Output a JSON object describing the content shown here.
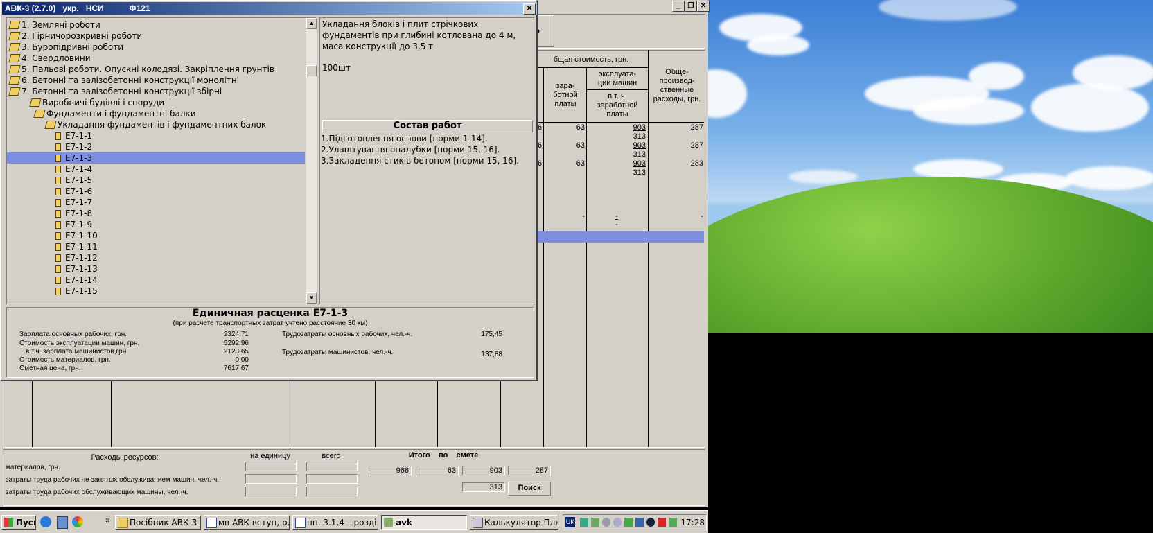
{
  "dialog": {
    "title": "АВК-3 (2.7.0)   укр.   НСИ           Ф121",
    "close": "✕"
  },
  "tree": [
    {
      "label": "1. Земляні роботи",
      "level": 0,
      "icon": "book-icon"
    },
    {
      "label": "2. Гірничорозкривні роботи",
      "level": 0,
      "icon": "book-icon"
    },
    {
      "label": "3. Буропідривні роботи",
      "level": 0,
      "icon": "book-icon"
    },
    {
      "label": "4. Свердловини",
      "level": 0,
      "icon": "book-icon"
    },
    {
      "label": "5. Пальові роботи. Опускні колодязі. Закріплення грунтів",
      "level": 0,
      "icon": "book-icon"
    },
    {
      "label": "6. Бетонні та залізобетонні конструкції монолітні",
      "level": 0,
      "icon": "book-icon"
    },
    {
      "label": "7. Бетонні та залізобетонні конструкції збірні",
      "level": 0,
      "icon": "open-book-icon"
    },
    {
      "label": "Виробничі будівлі і споруди",
      "level": 1,
      "icon": "open-book-icon"
    },
    {
      "label": "Фундаменти і фундаментні балки",
      "level": 2,
      "icon": "open-book-icon"
    },
    {
      "label": "Укладання фундаментів і фундаментних балок",
      "level": 3,
      "icon": "open-book-icon"
    },
    {
      "label": "Е7-1-1",
      "level": 4,
      "icon": "page-icon"
    },
    {
      "label": "Е7-1-2",
      "level": 4,
      "icon": "page-icon"
    },
    {
      "label": "Е7-1-3",
      "level": 4,
      "icon": "page-icon",
      "selected": true
    },
    {
      "label": "Е7-1-4",
      "level": 4,
      "icon": "page-icon"
    },
    {
      "label": "Е7-1-5",
      "level": 4,
      "icon": "page-icon"
    },
    {
      "label": "Е7-1-6",
      "level": 4,
      "icon": "page-icon"
    },
    {
      "label": "Е7-1-7",
      "level": 4,
      "icon": "page-icon"
    },
    {
      "label": "Е7-1-8",
      "level": 4,
      "icon": "page-icon"
    },
    {
      "label": "Е7-1-9",
      "level": 4,
      "icon": "page-icon"
    },
    {
      "label": "Е7-1-10",
      "level": 4,
      "icon": "page-icon"
    },
    {
      "label": "Е7-1-11",
      "level": 4,
      "icon": "page-icon"
    },
    {
      "label": "Е7-1-12",
      "level": 4,
      "icon": "page-icon"
    },
    {
      "label": "Е7-1-13",
      "level": 4,
      "icon": "page-icon"
    },
    {
      "label": "Е7-1-14",
      "level": 4,
      "icon": "page-icon"
    },
    {
      "label": "Е7-1-15",
      "level": 4,
      "icon": "page-icon"
    }
  ],
  "description": {
    "text": "Укладання блоків і плит стрічкових фундаментів при глибині котлована до 4 м, маса конструкції до 3,5 т",
    "unit": "100шт"
  },
  "works": {
    "header": "Состав работ",
    "items": [
      "1.Підготовлення основи [норми 1-14].",
      "2.Улаштування опалубки [норми 15, 16].",
      "3.Закладення стиків бетоном [норми 15, 16]."
    ]
  },
  "unit_price": {
    "title": "Единичная расценка Е7-1-3",
    "subtitle": "(при расчете транспортных затрат учтено расстояние 30 км)",
    "rows": [
      {
        "label": "Зарплата основных рабочих, грн.",
        "value": "2324,71"
      },
      {
        "label": "Стоимость эксплуатации машин, грн.",
        "value": "5292,96"
      },
      {
        "label": "в т.ч. зарплата машинистов,грн.",
        "value": "2123,65"
      },
      {
        "label": "Стоимость материалов, грн.",
        "value": "0,00"
      },
      {
        "label": "Сметная цена, грн.",
        "value": "7617,67"
      }
    ],
    "labor": [
      {
        "label": "Трудозатраты основных рабочих, чел.-ч.",
        "value": "175,45"
      },
      {
        "label": "Трудозатраты машинистов, чел.-ч.",
        "value": "137,88"
      }
    ]
  },
  "bg": {
    "button_fragment": "ого",
    "header_total": "бщая стоимость, грн.",
    "col_salary": "зара-\nботной\nплаты",
    "col_machines": "эксплуата-\nции машин",
    "col_machines_sub": "в т. ч.\nзаработной\nплаты",
    "col_overhead": "Обще-\nпроизвод-\nственные\nрасходы, грн.",
    "rows": [
      {
        "edge": "6",
        "salary": "63",
        "mach": "903",
        "mach_sub": "313",
        "over": "287"
      },
      {
        "edge": "6",
        "salary": "63",
        "mach": "903",
        "mach_sub": "313",
        "over": "287"
      },
      {
        "edge": "6",
        "salary": "63",
        "mach": "903",
        "mach_sub": "313",
        "over": "283"
      }
    ],
    "dash_row": {
      "salary": "-",
      "mach": "-",
      "mach_sub": "-",
      "over": "-"
    }
  },
  "resources": {
    "title": "Расходы ресурсов:",
    "per_unit": "на единицу",
    "total": "всего",
    "rows": [
      "материалов, грн.",
      "затраты труда рабочих не занятых обслуживанием машин, чел.-ч.",
      "затраты труда рабочих обслуживающих машины, чел.-ч."
    ],
    "summary_label": "Итого    по    смете",
    "summary": [
      "966",
      "63",
      "903",
      "287"
    ],
    "summary2": "313",
    "search_button": "Поиск"
  },
  "taskbar": {
    "start": "Пуск",
    "items": [
      {
        "label": "Посібник АВК-3 (...",
        "icon": "folder-icon"
      },
      {
        "label": "мв АВК вступ, р...",
        "icon": "word-icon"
      },
      {
        "label": "пп. 3.1.4 – розді...",
        "icon": "word-icon"
      },
      {
        "label": "avk",
        "icon": "app-icon",
        "active": true
      },
      {
        "label": "Калькулятор Плюс",
        "icon": "calculator-icon"
      }
    ],
    "lang": "UK",
    "clock": "17:28"
  }
}
